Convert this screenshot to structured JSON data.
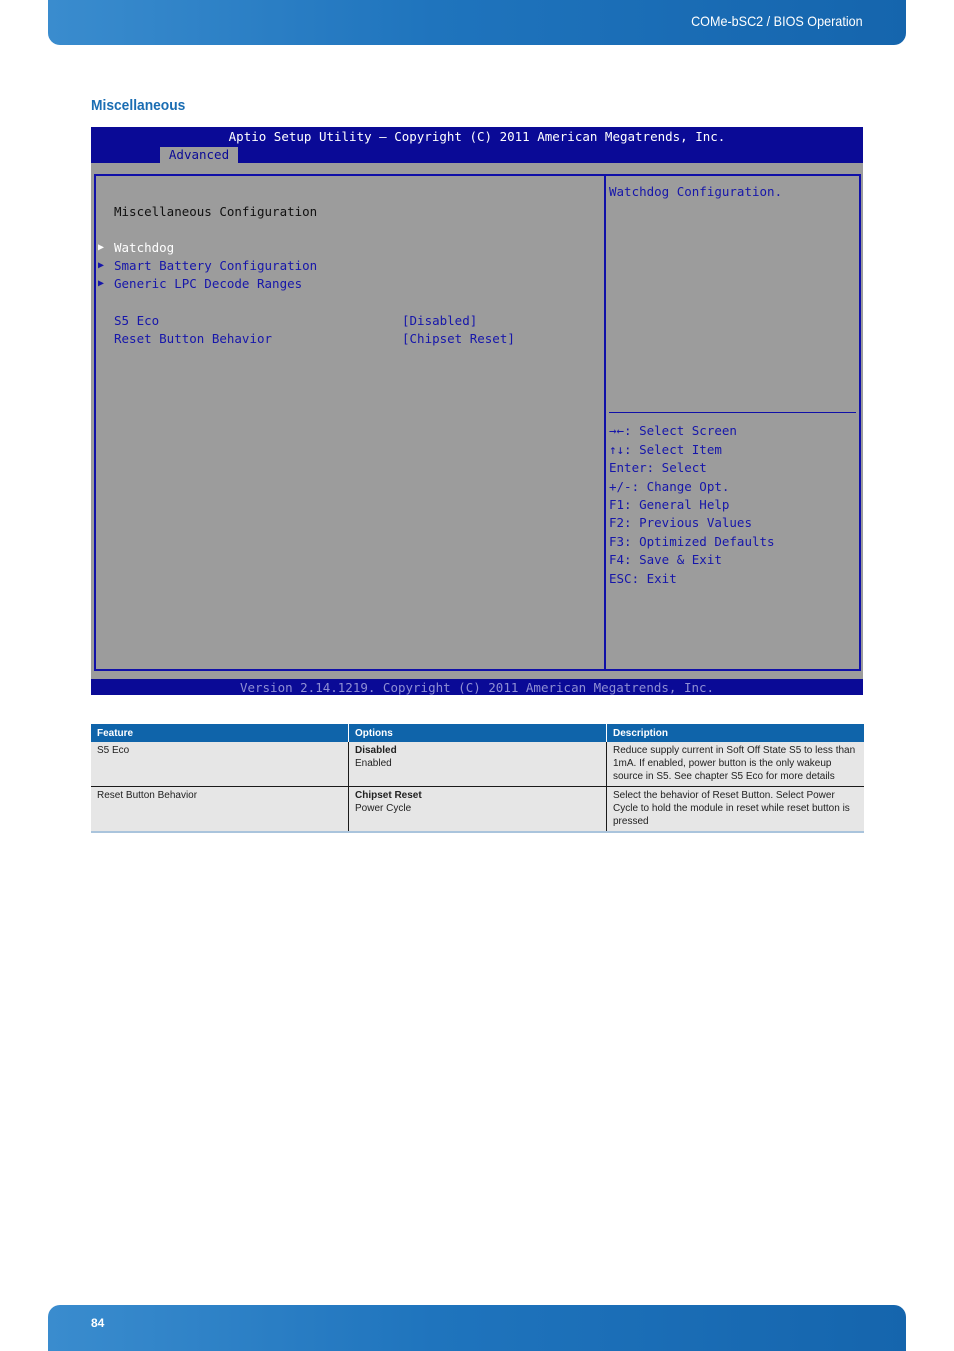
{
  "header": {
    "title": "COMe-bSC2 / BIOS Operation"
  },
  "section": {
    "title": "Miscellaneous"
  },
  "bios": {
    "title": "Aptio Setup Utility – Copyright (C) 2011 American Megatrends, Inc.",
    "active_tab": "Advanced",
    "heading": "Miscellaneous Configuration",
    "submenus": [
      {
        "label": "Watchdog",
        "selected": true
      },
      {
        "label": "Smart Battery Configuration",
        "selected": false
      },
      {
        "label": "Generic LPC Decode Ranges",
        "selected": false
      }
    ],
    "settings": [
      {
        "label": "S5 Eco",
        "value": "[Disabled]"
      },
      {
        "label": "Reset Button Behavior",
        "value": "[Chipset Reset]"
      }
    ],
    "help_text": "Watchdog Configuration.",
    "keys": [
      "→←: Select Screen",
      "↑↓: Select Item",
      "Enter: Select",
      "+/-: Change Opt.",
      "F1: General Help",
      "F2: Previous Values",
      "F3: Optimized Defaults",
      "F4: Save & Exit",
      "ESC: Exit"
    ],
    "version": "Version 2.14.1219. Copyright (C) 2011 American Megatrends, Inc.",
    "colors": {
      "bar": "#0a0a96",
      "background": "#9c9c9c",
      "text": "#1616aa"
    }
  },
  "table": {
    "headers": [
      "Feature",
      "Options",
      "Description"
    ],
    "rows": [
      {
        "feature": "S5 Eco",
        "default_option": "Disabled",
        "other_option": "Enabled",
        "description": "Reduce supply current in Soft Off State S5 to less than 1mA. If enabled, power button is the only wakeup source in S5. See chapter S5 Eco for more details"
      },
      {
        "feature": "Reset Button Behavior",
        "default_option": "Chipset Reset",
        "other_option": "Power Cycle",
        "description": "Select the behavior of Reset Button. Select Power Cycle to hold the module in reset while reset button is pressed"
      }
    ]
  },
  "footer": {
    "page_number": "84"
  }
}
